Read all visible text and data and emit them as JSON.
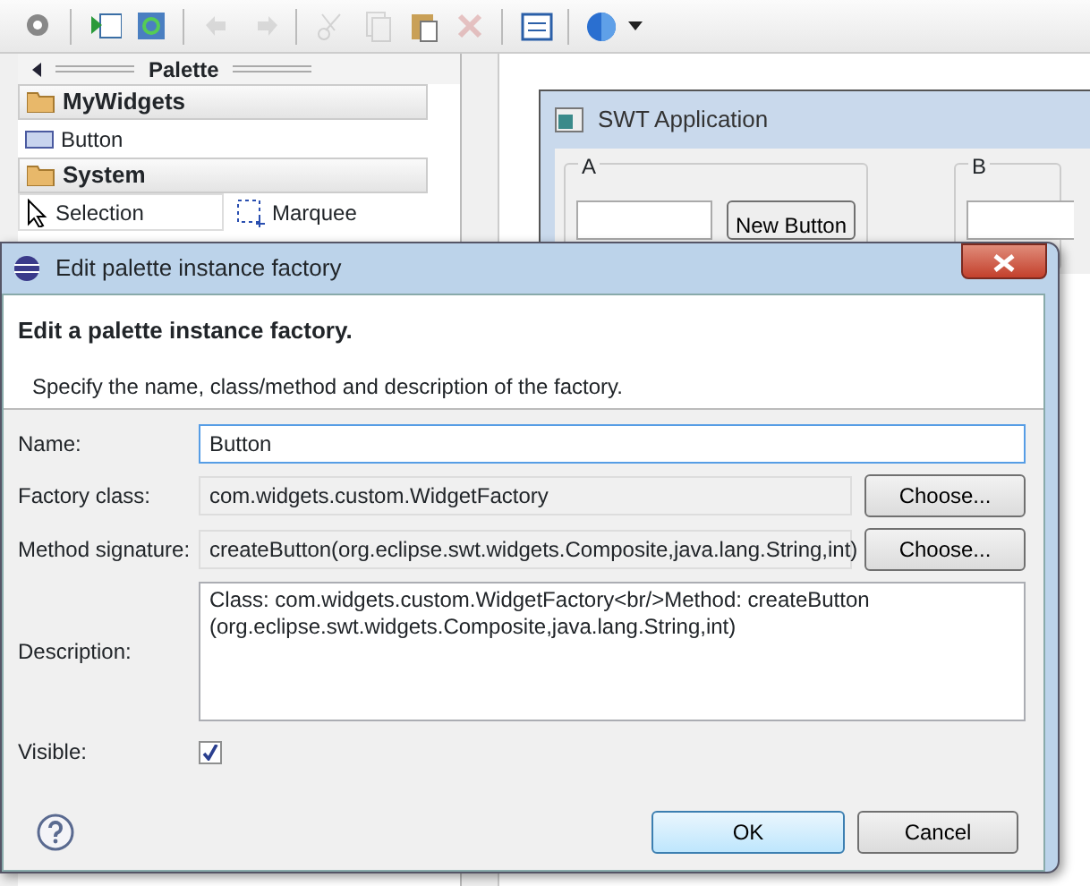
{
  "toolbar": {
    "buttons": [
      {
        "disabled": false
      },
      {
        "disabled": false
      },
      {
        "disabled": false
      },
      {
        "disabled": true
      },
      {
        "disabled": true
      },
      {
        "disabled": true
      },
      {
        "disabled": true
      },
      {
        "disabled": false
      },
      {
        "disabled": true
      },
      {
        "disabled": false
      },
      {
        "disabled": false
      }
    ]
  },
  "palette": {
    "title": "Palette",
    "groups": [
      {
        "label": "MyWidgets",
        "items": [
          {
            "label": "Button",
            "selected": false
          }
        ]
      },
      {
        "label": "System",
        "items": [
          {
            "label": "Selection",
            "selected": true
          },
          {
            "label": "Marquee",
            "selected": false
          }
        ]
      }
    ]
  },
  "design": {
    "window_title": "SWT Application",
    "groups": [
      "A",
      "B"
    ],
    "button": "New Button"
  },
  "dialog": {
    "title": "Edit palette instance factory",
    "heading": "Edit a palette instance factory.",
    "message": "Specify the name, class/method and description of the factory.",
    "fields": [
      {
        "kind": "input",
        "label": "Name:",
        "value": "Button",
        "focused": true
      },
      {
        "kind": "readonly",
        "label": "Factory class:",
        "value": "com.widgets.custom.WidgetFactory",
        "button": "Choose..."
      },
      {
        "kind": "readonly",
        "label": "Method signature:",
        "value": "createButton(org.eclipse.swt.widgets.Composite,java.lang.String,int)",
        "button": "Choose..."
      },
      {
        "kind": "textarea",
        "label": "Description:",
        "value": "Class: com.widgets.custom.WidgetFactory<br/>Method: createButton (org.eclipse.swt.widgets.Composite,java.lang.String,int)"
      },
      {
        "kind": "checkbox",
        "label": "Visible:",
        "checked": true
      }
    ],
    "buttons": [
      {
        "label": "OK",
        "default": true
      },
      {
        "label": "Cancel",
        "default": false
      }
    ]
  }
}
